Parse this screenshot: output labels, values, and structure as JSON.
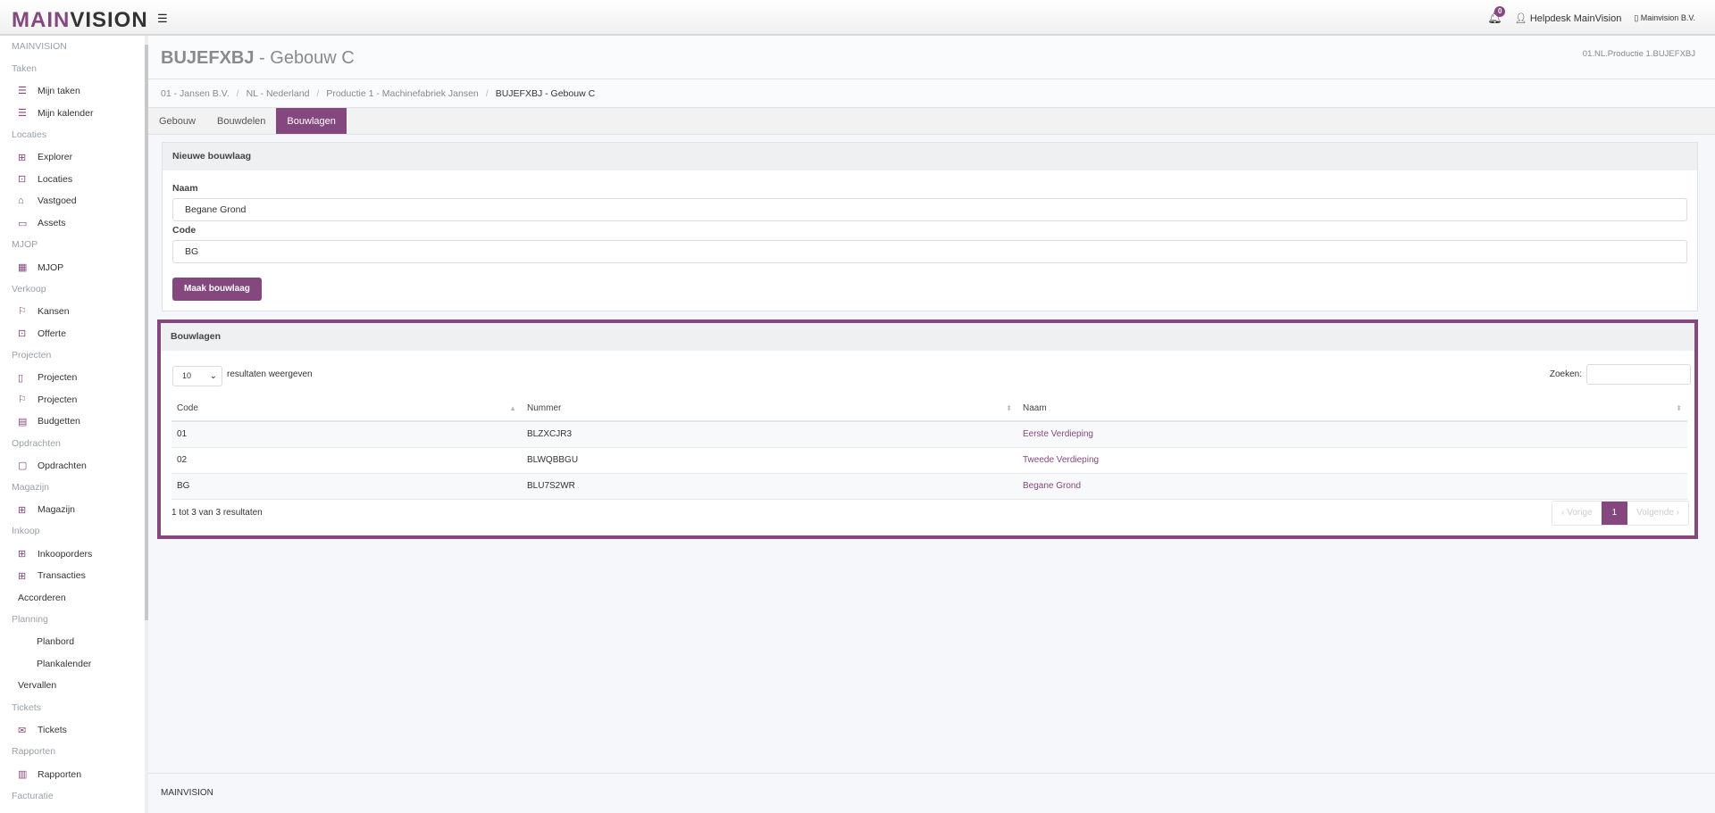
{
  "header": {
    "logo_a": "MAIN",
    "logo_b": "VISION",
    "notifications": "0",
    "user": "Helpdesk MainVision",
    "company": "Mainvision B.V."
  },
  "sidebar": {
    "sections": [
      {
        "label": "MAINVISION",
        "items": []
      },
      {
        "label": "Taken",
        "items": [
          {
            "label": "Mijn taken",
            "icon": "list"
          },
          {
            "label": "Mijn kalender",
            "icon": "list"
          }
        ]
      },
      {
        "label": "Locaties",
        "items": [
          {
            "label": "Explorer",
            "icon": "sitemap"
          },
          {
            "label": "Locaties",
            "icon": "briefcase"
          },
          {
            "label": "Vastgoed",
            "icon": "home"
          },
          {
            "label": "Assets",
            "icon": "folder"
          }
        ]
      },
      {
        "label": "MJOP",
        "items": [
          {
            "label": "MJOP",
            "icon": "calendar"
          }
        ]
      },
      {
        "label": "Verkoop",
        "items": [
          {
            "label": "Kansen",
            "icon": "signpost"
          },
          {
            "label": "Offerte",
            "icon": "briefcase"
          }
        ]
      },
      {
        "label": "Projecten",
        "items": [
          {
            "label": "Projecten",
            "icon": "book"
          },
          {
            "label": "Projecten",
            "icon": "signpost"
          },
          {
            "label": "Budgetten",
            "icon": "calculator"
          }
        ]
      },
      {
        "label": "Opdrachten",
        "items": [
          {
            "label": "Opdrachten",
            "icon": "file"
          }
        ]
      },
      {
        "label": "Magazijn",
        "items": [
          {
            "label": "Magazijn",
            "icon": "grid"
          }
        ]
      },
      {
        "label": "Inkoop",
        "items": [
          {
            "label": "Inkooporders",
            "icon": "grid"
          },
          {
            "label": "Transacties",
            "icon": "grid"
          },
          {
            "label": "Accorderen",
            "icon": ""
          }
        ]
      },
      {
        "label": "Planning",
        "items": [
          {
            "label": "Planbord",
            "icon": "blank"
          },
          {
            "label": "Plankalender",
            "icon": "blank"
          },
          {
            "label": "Vervallen",
            "icon": ""
          }
        ]
      },
      {
        "label": "Tickets",
        "items": [
          {
            "label": "Tickets",
            "icon": "envelope"
          }
        ]
      },
      {
        "label": "Rapporten",
        "items": [
          {
            "label": "Rapporten",
            "icon": "report"
          }
        ]
      },
      {
        "label": "Facturatie",
        "items": []
      }
    ]
  },
  "page": {
    "title_code": "BUJEFXBJ",
    "title_rest": " - Gebouw C",
    "code_ref": "01.NL.Productie 1.BUJEFXBJ"
  },
  "breadcrumb": [
    "01 - Jansen B.V.",
    "NL - Nederland",
    "Productie 1 - Machinefabriek Jansen",
    "BUJEFXBJ - Gebouw C"
  ],
  "tabs": [
    "Gebouw",
    "Bouwdelen",
    "Bouwlagen"
  ],
  "form": {
    "title": "Nieuwe bouwlaag",
    "naam_label": "Naam",
    "naam_value": "Begane Grond",
    "code_label": "Code",
    "code_value": "BG",
    "submit": "Maak bouwlaag"
  },
  "list": {
    "title": "Bouwlagen",
    "page_size": "10",
    "page_size_label": "resultaten weergeven",
    "search_label": "Zoeken:",
    "columns": [
      "Code",
      "Nummer",
      "Naam"
    ],
    "rows": [
      [
        "01",
        "BLZXCJR3",
        "Eerste Verdieping"
      ],
      [
        "02",
        "BLWQBBGU",
        "Tweede Verdieping"
      ],
      [
        "BG",
        "BLU7S2WR",
        "Begane Grond"
      ]
    ],
    "info": "1 tot 3 van 3 resultaten",
    "prev": "Vorige",
    "page": "1",
    "next": "Volgende"
  },
  "footer": "MAINVISION",
  "colors": {
    "accent": "#84487e"
  }
}
